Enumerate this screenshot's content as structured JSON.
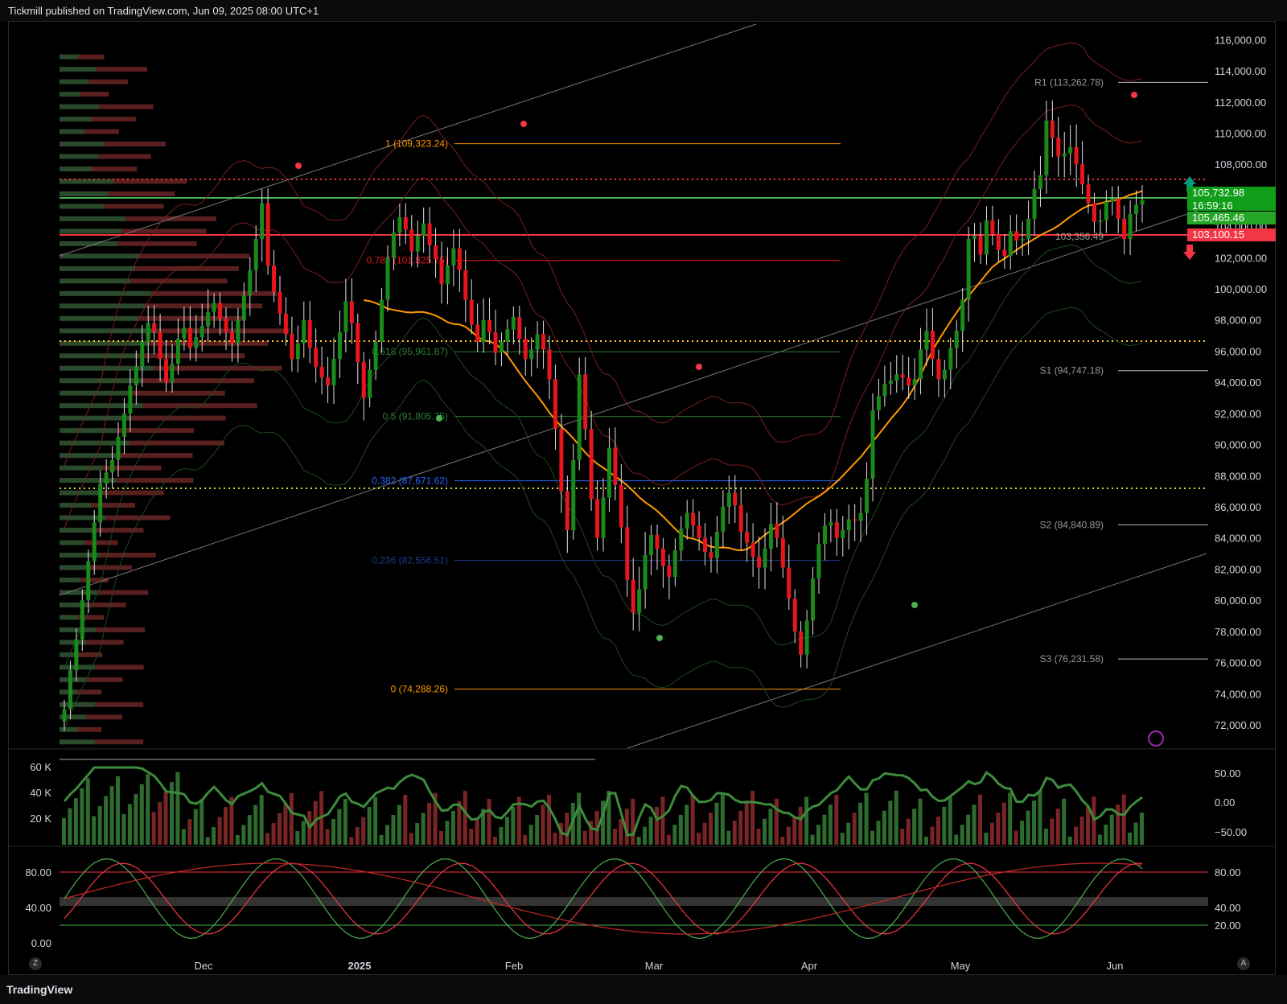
{
  "header": {
    "publisher": "Tickmill published on TradingView.com, Jun 09, 2025 08:00 UTC+1"
  },
  "footer": {
    "brand": "TradingView",
    "left_btn": "Z",
    "right_btn": "A"
  },
  "price_labels": {
    "last": "105,732.98",
    "countdown": "16:59:16",
    "green_level": "105,465.46",
    "red_level": "103,100.15"
  },
  "colors": {
    "up": "#089981",
    "candle_up": "#1a8a1a",
    "candle_down": "#e8151d",
    "orange": "#ff9800",
    "panel_bg": "#000000"
  },
  "chart_data": [
    {
      "type": "candlestick",
      "title": "",
      "x_ticks": [
        "Dec",
        "2025",
        "Feb",
        "Mar",
        "Apr",
        "May",
        "Jun"
      ],
      "y_ticks": [
        "116,000.00",
        "114,000.00",
        "112,000.00",
        "110,000.00",
        "108,000.00",
        "106,000.00",
        "104,000.00",
        "102,000.00",
        "100,000.00",
        "98,000.00",
        "96,000.00",
        "94,000.00",
        "92,000.00",
        "90,000.00",
        "88,000.00",
        "86,000.00",
        "84,000.00",
        "82,000.00",
        "80,000.00",
        "78,000.00",
        "76,000.00",
        "74,000.00",
        "72,000.00"
      ],
      "ylim": [
        70500,
        117000
      ],
      "pivots": [
        {
          "label": "R1 (113,262.78)",
          "value": 113262.78
        },
        {
          "label": "S1 (94,747.18)",
          "value": 94747.18
        },
        {
          "label": "S2 (84,840.89)",
          "value": 84840.89
        },
        {
          "label": "S3 (76,231.58)",
          "value": 76231.58
        }
      ],
      "fib_levels": [
        {
          "label": "1 (109,323.24)",
          "value": 109323.24,
          "color": "#ff9800"
        },
        {
          "label": "0.786 (101,825.75)",
          "value": 101825.75,
          "color": "#e8151d"
        },
        {
          "label": "0.618 (95,961.87)",
          "value": 95961.87,
          "color": "#2e7d32"
        },
        {
          "label": "0.5 (91,805.75)",
          "value": 91805.75,
          "color": "#2e7d32"
        },
        {
          "label": "0.382 (87,671.62)",
          "value": 87671.62,
          "color": "#2962ff"
        },
        {
          "label": "0.236 (82,556.51)",
          "value": 82556.51,
          "color": "#1e3a8a"
        },
        {
          "label": "0 (74,288.26)",
          "value": 74288.26,
          "color": "#ff9800"
        }
      ],
      "extra_labels": [
        "103,356.49"
      ],
      "close_series": [
        73000,
        75500,
        77500,
        80000,
        82500,
        85000,
        87500,
        88200,
        89000,
        90500,
        92000,
        93800,
        95000,
        96600,
        97800,
        97200,
        95500,
        94000,
        95200,
        96800,
        97500,
        96200,
        96900,
        97600,
        98500,
        99100,
        98100,
        97200,
        96500,
        98000,
        99600,
        101200,
        103200,
        105500,
        101500,
        99800,
        98400,
        97100,
        95500,
        96500,
        98000,
        96200,
        95000,
        94300,
        93800,
        95500,
        97200,
        99200,
        97800,
        95300,
        93000,
        94800,
        96600,
        99300,
        102000,
        103600,
        104600,
        103800,
        102400,
        103400,
        104200,
        102800,
        101900,
        100300,
        101500,
        102600,
        101200,
        99300,
        97700,
        96600,
        98000,
        97200,
        95900,
        96600,
        97400,
        98200,
        96800,
        95500,
        96100,
        97100,
        96100,
        94200,
        91000,
        87000,
        84500,
        89000,
        94500,
        91000,
        86500,
        84000,
        86600,
        89800,
        87400,
        84700,
        81300,
        79200,
        80700,
        82900,
        84200,
        83300,
        82200,
        81500,
        83200,
        84600,
        85600,
        84800,
        84000,
        83100,
        82700,
        84400,
        86000,
        86900,
        86100,
        84400,
        83700,
        82800,
        82100,
        83300,
        84900,
        84000,
        82100,
        80100,
        78000,
        76500,
        78700,
        81400,
        83600,
        84800,
        85000,
        84000,
        84500,
        85200,
        85100,
        85600,
        87800,
        92200,
        93100,
        93900,
        94100,
        94500,
        94300,
        93800,
        94200,
        96100,
        97300,
        95500,
        94200,
        94800,
        96200,
        97300,
        99300,
        103200,
        103400,
        102200,
        104400,
        103500,
        102500,
        102100,
        103700,
        103100,
        103200,
        104500,
        106400,
        107300,
        110800,
        109700,
        108500,
        108700,
        109100,
        108000,
        106700,
        105500,
        104300,
        104400,
        105600,
        105800,
        104500,
        103200,
        104800,
        105400,
        105700
      ],
      "bands": [
        "upper outer",
        "upper inner",
        "lower inner",
        "lower outer",
        "ma50",
        "ma200"
      ]
    },
    {
      "type": "bar",
      "title": "",
      "y_ticks_left": [
        "60 K",
        "40 K",
        "20 K"
      ],
      "y_ticks_right": [
        "50.00",
        "0.00",
        "−50.00"
      ],
      "description_series": "volume histogram with oscillator line"
    },
    {
      "type": "line",
      "title": "",
      "y_ticks_left": [
        "80.00",
        "40.00",
        "0.00"
      ],
      "y_ticks_right": [
        "80.00",
        "40.00",
        "20.00"
      ],
      "levels": [
        80,
        50,
        20
      ]
    }
  ]
}
